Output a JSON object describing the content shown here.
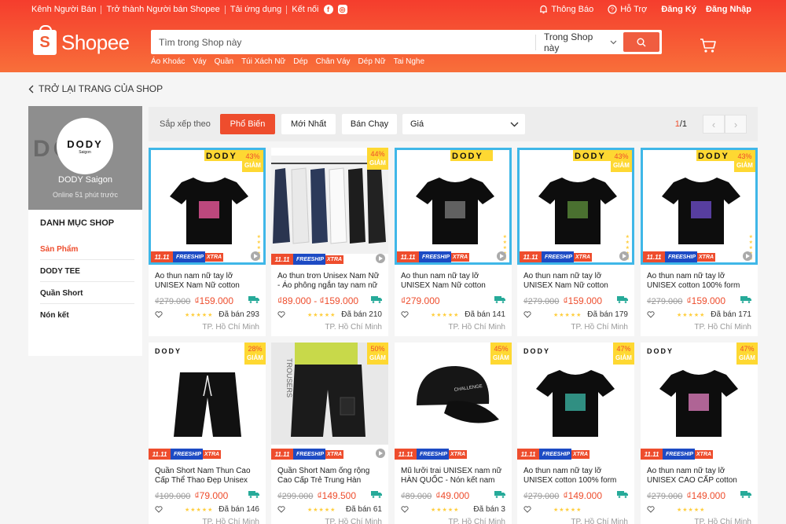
{
  "topbar": {
    "seller_channel": "Kênh Người Bán",
    "become_seller": "Trở thành Người bán Shopee",
    "download": "Tải ứng dụng",
    "connect": "Kết nối",
    "notifications": "Thông Báo",
    "help": "Hỗ Trợ",
    "register": "Đăng Ký",
    "login": "Đăng Nhập"
  },
  "logo": {
    "glyph": "S",
    "text": "Shopee"
  },
  "search": {
    "placeholder": "Tìm trong Shop này",
    "scope": "Trong Shop này",
    "keywords": [
      "Áo Khoác",
      "Váy",
      "Quần",
      "Túi Xách Nữ",
      "Dép",
      "Chân Váy",
      "Dép Nữ",
      "Tai Nghe"
    ]
  },
  "back": {
    "label": "TRỞ LẠI TRANG CỦA SHOP"
  },
  "shop": {
    "brand": "DODY",
    "brand_sub": "Saigon",
    "name": "DODY Saigon",
    "online": "Online 51 phút trước"
  },
  "categories": {
    "title": "DANH MỤC SHOP",
    "items": [
      "Sản Phẩm",
      "DODY TEE",
      "Quần Short",
      "Nón kết"
    ]
  },
  "sort": {
    "label": "Sắp xếp theo",
    "options": [
      "Phổ Biến",
      "Mới Nhất",
      "Bán Chạy"
    ],
    "price": "Giá",
    "page_current": "1",
    "page_total": "/1"
  },
  "promo": {
    "d1111": "11.11",
    "freeship": "FREESHIP",
    "xtra": "XTRA",
    "discount_word": "GIẢM"
  },
  "products": [
    {
      "name": "Áo thun nam nữ tay lỡ UNISEX Nam Nữ cotton 100% form...",
      "old": "₫279.000",
      "price": "₫159.000",
      "discount": "43%",
      "sold": "Đã bán 293",
      "loc": "TP. Hồ Chí Minh",
      "tee_text": "AMAZING"
    },
    {
      "name": "Áo thun trơn Unisex Nam Nữ - Áo phông ngắn tay nam nữ 3...",
      "old": "",
      "price": "₫89.000 - ₫159.000",
      "discount": "44%",
      "sold": "Đã bán 210",
      "loc": "TP. Hồ Chí Minh",
      "tee_text": ""
    },
    {
      "name": "Áo thun nam nữ tay lỡ UNISEX Nam Nữ cotton 100% form...",
      "old": "",
      "price": "₫279.000",
      "discount": "",
      "sold": "Đã bán 141",
      "loc": "TP. Hồ Chí Minh",
      "tee_text": ""
    },
    {
      "name": "Áo thun nam nữ tay lỡ UNISEX Nam Nữ cotton 100% form...",
      "old": "₫279.000",
      "price": "₫159.000",
      "discount": "43%",
      "sold": "Đã bán 179",
      "loc": "TP. Hồ Chí Minh",
      "tee_text": ""
    },
    {
      "name": "Áo thun nam nữ tay lỡ UNISEX cotton 100% form rộng - LIF...",
      "old": "₫279.000",
      "price": "₫159.000",
      "discount": "43%",
      "sold": "Đã bán 171",
      "loc": "TP. Hồ Chí Minh",
      "tee_text": ""
    },
    {
      "name": "Quần Short Nam Thun Cao Cấp Thể Thao Đẹp Unisex Nam N...",
      "old": "₫109.000",
      "price": "₫79.000",
      "discount": "28%",
      "sold": "Đã bán 146",
      "loc": "TP. Hồ Chí Minh",
      "tee_text": ""
    },
    {
      "name": "Quần Short Nam ống rộng Cao Cấp Trẻ Trung Hàn Quốc...",
      "old": "₫299.000",
      "price": "₫149.500",
      "discount": "50%",
      "sold": "Đã bán 61",
      "loc": "TP. Hồ Chí Minh",
      "tee_text": ""
    },
    {
      "name": "Mũ lưỡi trai UNISEX nam nữ HÀN QUỐC - Nón kết nam tr...",
      "old": "₫89.000",
      "price": "₫49.000",
      "discount": "45%",
      "sold": "Đã bán 3",
      "loc": "TP. Hồ Chí Minh",
      "tee_text": "CHALLENGE"
    },
    {
      "name": "Áo thun nam nữ tay lỡ UNISEX cotton 100% form rộng cao c...",
      "old": "₫279.000",
      "price": "₫149.000",
      "discount": "47%",
      "sold": "",
      "loc": "TP. Hồ Chí Minh",
      "tee_text": ""
    },
    {
      "name": "Áo thun nam nữ tay lỡ UNISEX CAO CẤP cotton 100% form...",
      "old": "₫279.000",
      "price": "₫149.000",
      "discount": "47%",
      "sold": "",
      "loc": "TP. Hồ Chí Minh",
      "tee_text": ""
    }
  ],
  "colors": {
    "brand": "#ee4d2d",
    "badge": "#fed832",
    "freeship": "#1d4bc4"
  }
}
